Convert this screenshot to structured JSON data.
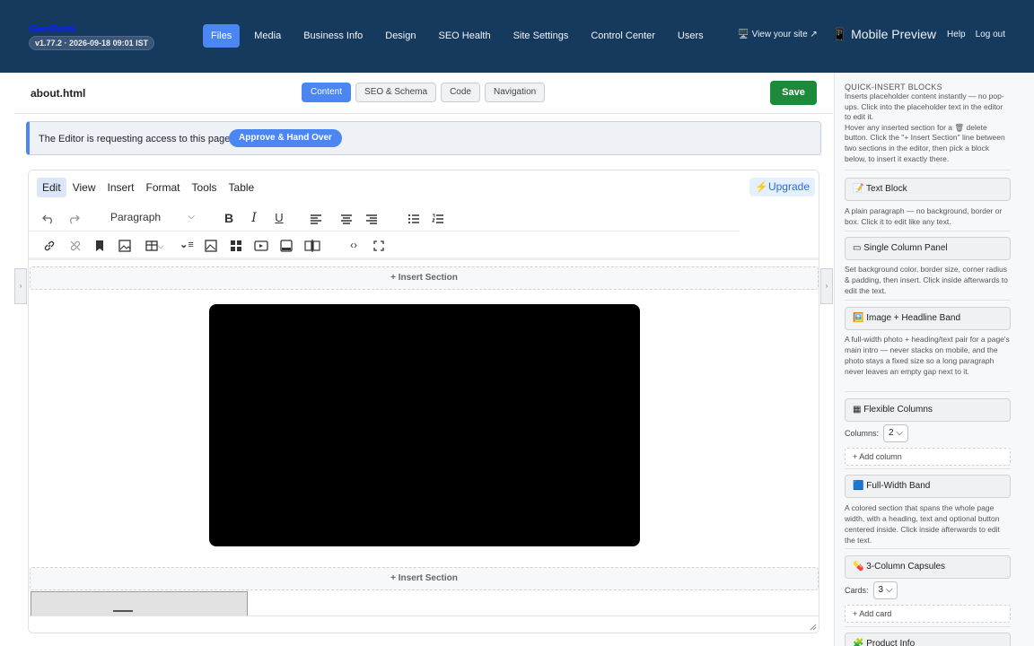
{
  "header": {
    "brand": "GeoRank",
    "version": "v1.77.2 · 2026-09-18 09:01 IST",
    "nav": [
      "Files",
      "Media",
      "Business Info",
      "Design",
      "SEO Health",
      "Site Settings",
      "Control Center",
      "Users"
    ],
    "active_nav": "Files",
    "view_site": "🖥️ View your site ↗",
    "mobile_preview": "📱 Mobile Preview",
    "help": "Help",
    "logout": "Log out"
  },
  "filebar": {
    "filename": "about.html",
    "tabs": [
      "Content",
      "SEO & Schema",
      "Code",
      "Navigation"
    ],
    "active_tab": "Content",
    "save": "Save"
  },
  "request": {
    "text": "The Editor is requesting access to this page.",
    "approve": "Approve & Hand Over"
  },
  "editor": {
    "menu": [
      "Edit",
      "View",
      "Insert",
      "Format",
      "Tools",
      "Table"
    ],
    "upgrade": "⚡Upgrade",
    "paragraph_select": "Paragraph",
    "insert_section": "+ Insert Section"
  },
  "sidebar": {
    "heading": "QUICK-INSERT BLOCKS",
    "intro1": "Inserts placeholder content instantly — no pop-ups. Click into the placeholder text in the editor to edit it.",
    "intro2": "Hover any inserted section for a 🗑 delete button. Click the \"+ Insert Section\" line between two sections in the editor, then pick a block below, to insert it exactly there.",
    "text_block": "📝 Text Block",
    "text_block_desc": "A plain paragraph — no background, border or box. Click it to edit like any text.",
    "single_col": "▭ Single Column Panel",
    "single_col_desc": "Set background color, border size, corner radius & padding, then insert. Click inside afterwards to edit the text.",
    "image_band": "🖼️ Image + Headline Band",
    "image_band_desc": "A full-width photo + heading/text pair for a page's main intro — never stacks on mobile, and the photo stays a fixed size so a long paragraph never leaves an empty gap next to it.",
    "flex_cols": "▦ Flexible Columns",
    "columns_label": "Columns:",
    "columns_value": "2",
    "add_column": "+ Add column",
    "full_band": "🟦 Full-Width Band",
    "full_band_desc": "A colored section that spans the whole page width, with a heading, text and optional button centered inside. Click inside afterwards to edit the text.",
    "capsules": "💊 3-Column Capsules",
    "cards_label": "Cards:",
    "cards_value": "3",
    "add_card": "+ Add card",
    "product_info": "🧩 Product Info"
  }
}
